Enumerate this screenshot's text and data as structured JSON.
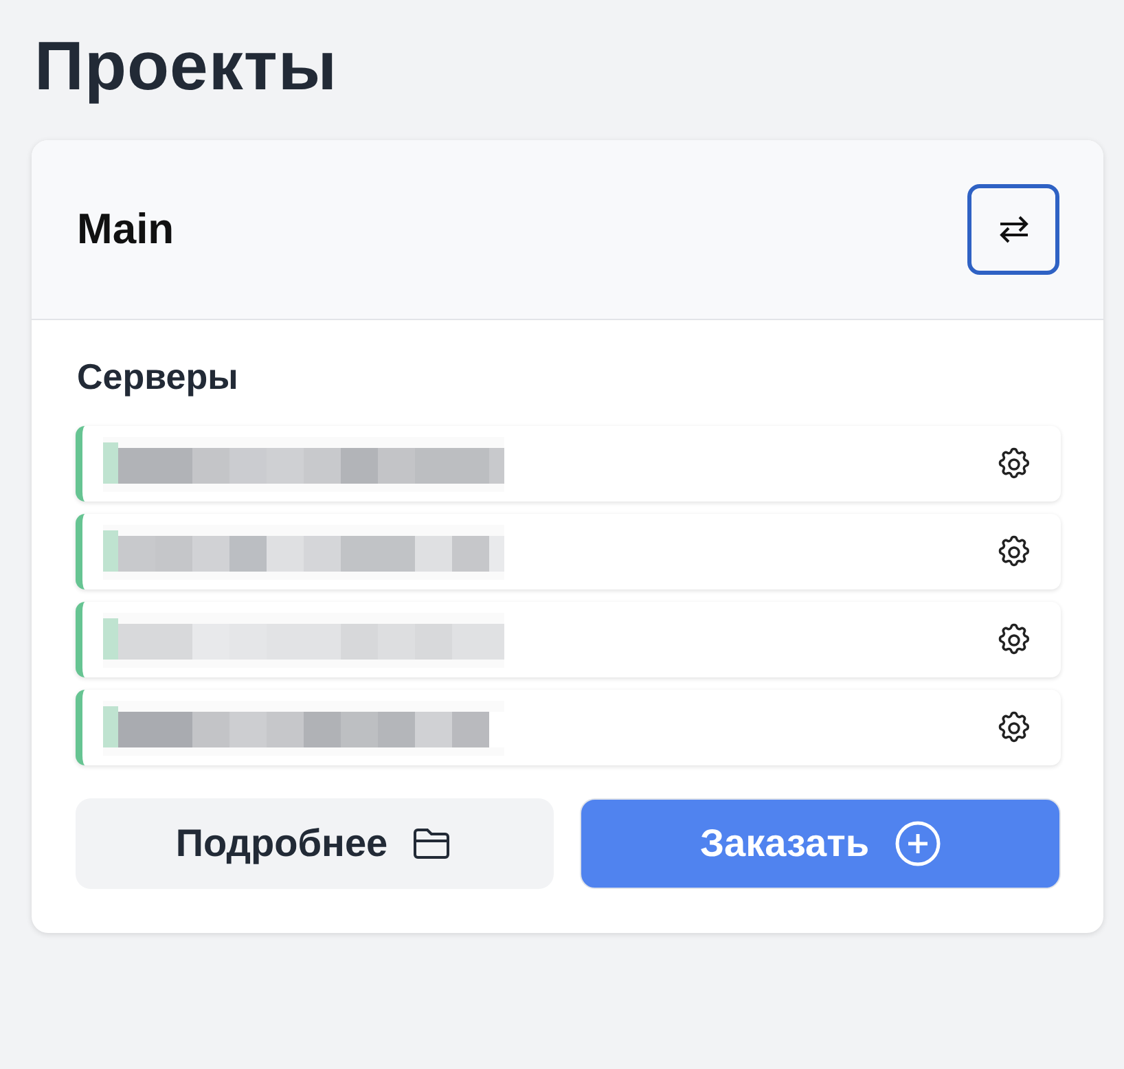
{
  "page_title": "Проекты",
  "project": {
    "name": "Main",
    "switch_button": {
      "focused": true
    }
  },
  "section_title": "Серверы",
  "servers": [
    {
      "color": "#66c492"
    },
    {
      "color": "#66c492"
    },
    {
      "color": "#66c492"
    },
    {
      "color": "#66c492"
    }
  ],
  "buttons": [
    {
      "label": "Подробнее",
      "kind": "secondary"
    },
    {
      "label": "Заказать",
      "kind": "primary"
    }
  ]
}
